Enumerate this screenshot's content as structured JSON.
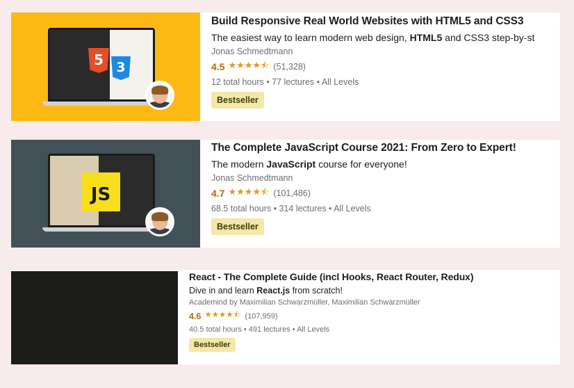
{
  "courses": [
    {
      "title": "Build Responsive Real World Websites with HTML5 and CSS3",
      "subtitle_pre": "The easiest way to learn modern web design, ",
      "subtitle_bold": "HTML5",
      "subtitle_post": " and CSS3 step-by-st",
      "author": "Jonas Schmedtmann",
      "rating": "4.5",
      "stars": "★★★★⯪",
      "reviews": "(51,328)",
      "meta": "12 total hours • 77 lectures • All Levels",
      "badge": "Bestseller",
      "thumb_bg": "#fdb813"
    },
    {
      "title": "The Complete JavaScript Course 2021: From Zero to Expert!",
      "subtitle_pre": "The modern ",
      "subtitle_bold": "JavaScript",
      "subtitle_post": " course for everyone!",
      "author": "Jonas Schmedtmann",
      "rating": "4.7",
      "stars": "★★★★⯪",
      "reviews": "(101,486)",
      "meta": "68.5 total hours • 314 lectures • All Levels",
      "badge": "Bestseller",
      "thumb_bg": "#425057",
      "js_label": "JS"
    },
    {
      "title": "React - The Complete Guide (incl Hooks, React Router, Redux)",
      "subtitle_pre": "Dive in and learn ",
      "subtitle_bold": "React.js",
      "subtitle_post": " from scratch!",
      "author": "Academind by Maximilian Schwarzmüller, Maximilian Schwarzmüller",
      "rating": "4.6",
      "stars": "★★★★⯪",
      "reviews": "(107,959)",
      "meta": "40.5 total hours • 491 lectures • All Levels",
      "badge": "Bestseller",
      "thumb_bg": "#1c1d1b"
    }
  ],
  "colors": {
    "page_bg": "#f8ebeb",
    "rating": "#b4690e",
    "stars": "#e59819",
    "badge_bg": "#f3e8a7",
    "html5_orange": "#e44d26",
    "css3_blue": "#1e88e5",
    "js_yellow": "#f7df1e"
  }
}
